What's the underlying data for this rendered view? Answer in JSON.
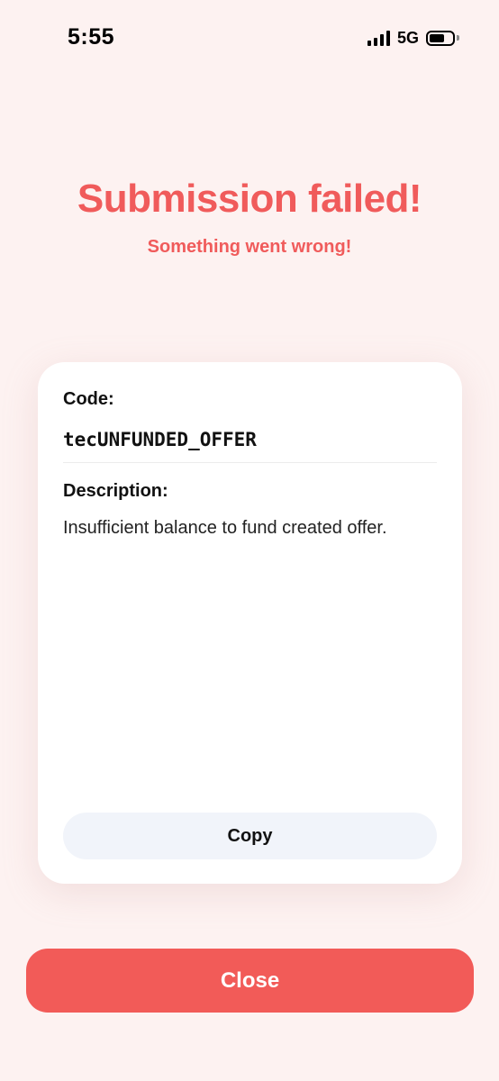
{
  "status_bar": {
    "time": "5:55",
    "network": "5G",
    "icons": [
      "signal-bars-icon",
      "battery-icon"
    ]
  },
  "header": {
    "title": "Submission failed!",
    "subtitle": "Something went wrong!"
  },
  "error_card": {
    "code_label": "Code:",
    "code_value": "tecUNFUNDED_OFFER",
    "description_label": "Description:",
    "description_value": "Insufficient balance to fund created offer.",
    "copy_label": "Copy"
  },
  "footer": {
    "close_label": "Close"
  },
  "colors": {
    "background": "#fdf2f1",
    "accent": "#f05b5b",
    "close_button": "#f25b58",
    "copy_button": "#f1f4fa"
  }
}
